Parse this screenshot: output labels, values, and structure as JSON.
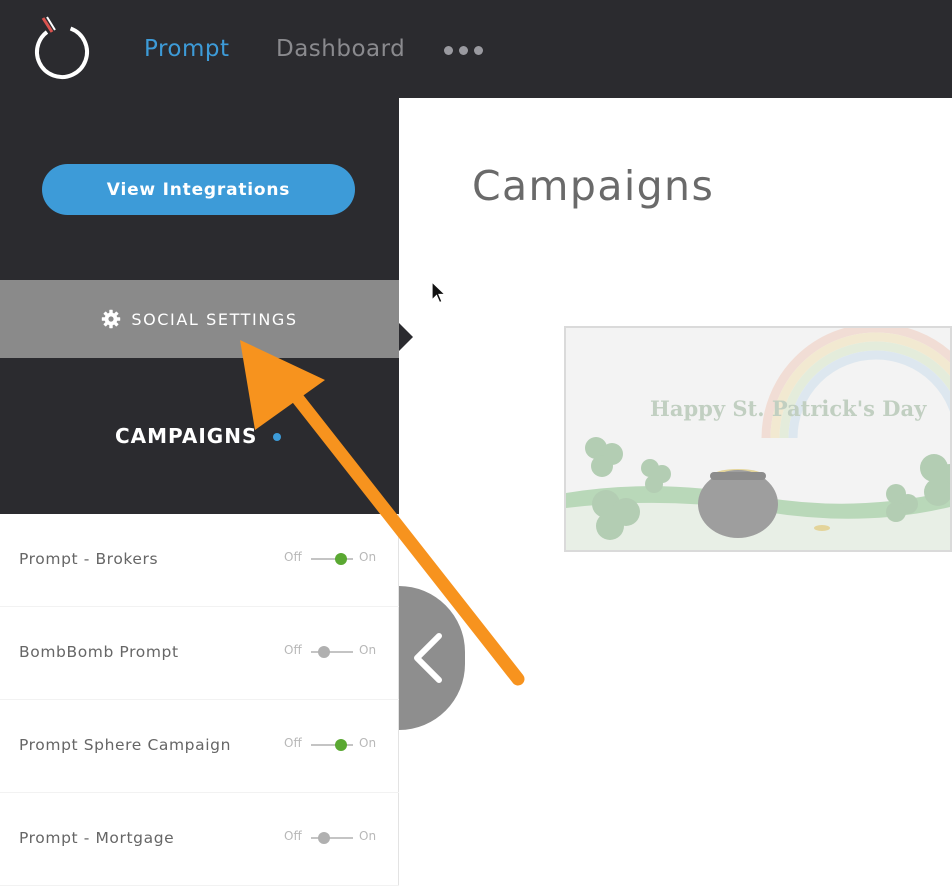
{
  "nav": {
    "prompt": "Prompt",
    "dashboard": "Dashboard",
    "more_icon": "ellipsis-icon",
    "accent_color": "#3d9bd8"
  },
  "sidebar": {
    "view_integrations": "View Integrations",
    "social_settings": "SOCIAL SETTINGS",
    "campaigns_heading": "CAMPAIGNS",
    "campaigns": [
      {
        "name": "Prompt - Brokers",
        "off": "Off",
        "on": "On",
        "enabled": true
      },
      {
        "name": "BombBomb Prompt",
        "off": "Off",
        "on": "On",
        "enabled": false
      },
      {
        "name": "Prompt Sphere Campaign",
        "off": "Off",
        "on": "On",
        "enabled": true
      },
      {
        "name": "Prompt - Mortgage",
        "off": "Off",
        "on": "On",
        "enabled": false
      }
    ]
  },
  "main": {
    "title": "Campaigns",
    "card_title": "Happy St. Patrick's Day"
  },
  "colors": {
    "dark": "#2b2b2f",
    "toggle_on": "#5aa832",
    "annotation_arrow": "#f7931e"
  }
}
